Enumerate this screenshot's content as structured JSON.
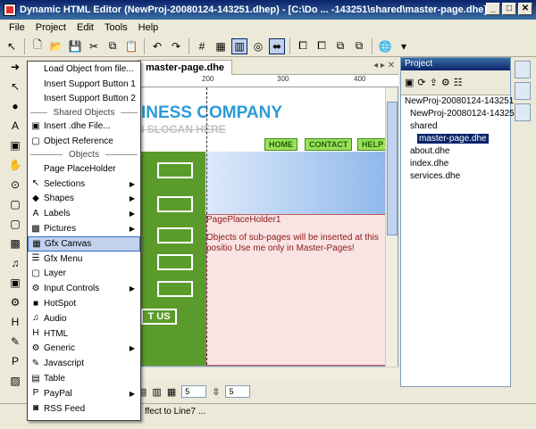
{
  "window": {
    "title": "Dynamic HTML Editor (NewProj-20080124-143251.dhep) - [C:\\Do ... -143251\\shared\\master-page.dhe]"
  },
  "menubar": [
    "File",
    "Project",
    "Edit",
    "Tools",
    "Help"
  ],
  "doc_tab": "master-page.dhe",
  "ruler": [
    "200",
    "300",
    "400"
  ],
  "page": {
    "company": "INESS COMPANY",
    "slogan": "I SLOGAN HERE",
    "nav": [
      "HOME",
      "CONTACT",
      "HELP"
    ],
    "green_label": "T US",
    "placeholder_name": "PagePlaceHolder1",
    "placeholder_text": "Objects of sub-pages will be inserted at this positio Use me only in Master-Pages!"
  },
  "menu": {
    "items_top": [
      "Load Object from file...",
      "Insert Support Button 1",
      "Insert Support Button 2"
    ],
    "header_shared": "Shared Objects",
    "insert_dhe": "Insert .dhe File...",
    "object_reference": "Object Reference",
    "header_objects": "Objects",
    "page_placeholder": "Page PlaceHolder",
    "items": [
      "Selections",
      "Shapes",
      "Labels",
      "Pictures",
      "Gfx Canvas",
      "Gfx Menu",
      "Layer",
      "Input Controls",
      "HotSpot",
      "Audio",
      "HTML",
      "Generic",
      "Javascript",
      "Table",
      "PayPal",
      "RSS Feed"
    ],
    "highlighted": "Gfx Canvas"
  },
  "project": {
    "header": "Project",
    "tree": [
      "NewProj-20080124-143251",
      "NewProj-20080124-14325",
      "shared",
      "master-page.dhe",
      "about.dhe",
      "index.dhe",
      "services.dhe"
    ],
    "selected": "master-page.dhe"
  },
  "bottom": {
    "spin1": "5",
    "spin2": "5"
  },
  "status": "ffect to Line7 ..."
}
